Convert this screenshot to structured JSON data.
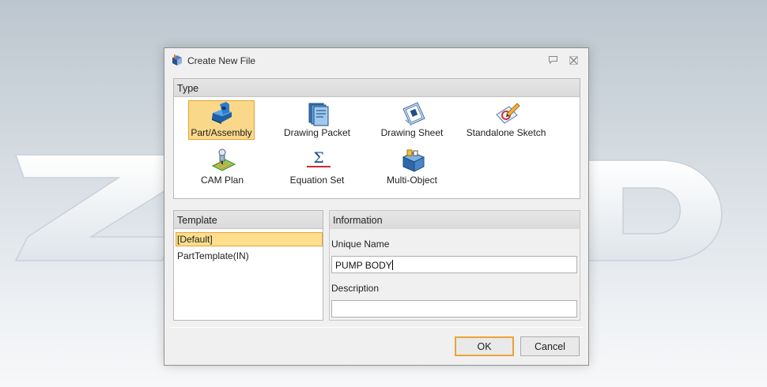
{
  "dialog": {
    "title": "Create New File"
  },
  "type_section": {
    "header": "Type",
    "items": [
      {
        "label": "Part/Assembly",
        "icon": "part-assembly-icon",
        "selected": true
      },
      {
        "label": "Drawing Packet",
        "icon": "drawing-packet-icon",
        "selected": false
      },
      {
        "label": "Drawing Sheet",
        "icon": "drawing-sheet-icon",
        "selected": false
      },
      {
        "label": "Standalone Sketch",
        "icon": "standalone-sketch-icon",
        "selected": false
      },
      {
        "label": "CAM Plan",
        "icon": "cam-plan-icon",
        "selected": false
      },
      {
        "label": "Equation Set",
        "icon": "equation-set-icon",
        "selected": false
      },
      {
        "label": "Multi-Object",
        "icon": "multi-object-icon",
        "selected": false
      }
    ]
  },
  "template_section": {
    "header": "Template",
    "items": [
      {
        "label": "[Default]",
        "selected": true
      },
      {
        "label": "PartTemplate(IN)",
        "selected": false
      }
    ]
  },
  "information_section": {
    "header": "Information",
    "unique_name_label": "Unique Name",
    "unique_name_value": "PUMP BODY",
    "description_label": "Description",
    "description_value": ""
  },
  "buttons": {
    "ok": "OK",
    "cancel": "Cancel"
  },
  "colors": {
    "selection_fill": "#fad88a",
    "selection_border": "#e6a230",
    "ok_focus_border": "#e8a33a"
  }
}
